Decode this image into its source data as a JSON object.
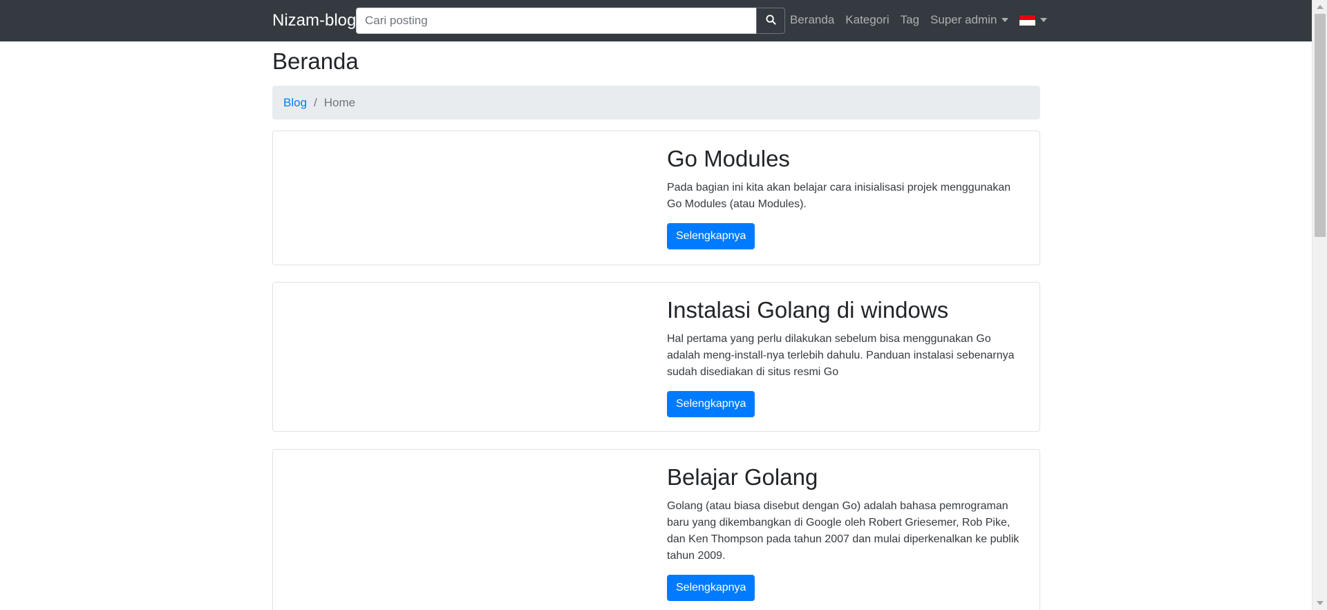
{
  "navbar": {
    "brand": "Nizam-blog",
    "search_placeholder": "Cari posting",
    "search_icon": "search-icon",
    "links": [
      {
        "label": "Beranda"
      },
      {
        "label": "Kategori"
      },
      {
        "label": "Tag"
      }
    ],
    "user_menu": "Super admin",
    "language_flag": "indonesia-flag-icon"
  },
  "page": {
    "title": "Beranda"
  },
  "breadcrumb": {
    "link": "Blog",
    "separator": "/",
    "active": "Home"
  },
  "posts": [
    {
      "title": "Go Modules",
      "excerpt": "Pada bagian ini kita akan belajar cara inisialisasi projek menggunakan Go Modules (atau Modules).",
      "button": "Selengkapnya"
    },
    {
      "title": "Instalasi Golang di windows",
      "excerpt": "Hal pertama yang perlu dilakukan sebelum bisa menggunakan Go adalah meng-install-nya terlebih dahulu. Panduan instalasi sebenarnya sudah disediakan di situs resmi Go",
      "button": "Selengkapnya"
    },
    {
      "title": "Belajar Golang",
      "excerpt": "Golang (atau biasa disebut dengan Go) adalah bahasa pemrograman baru yang dikembangkan di Google oleh Robert Griesemer, Rob Pike, dan Ken Thompson pada tahun 2007 dan mulai diperkenalkan ke publik tahun 2009.",
      "button": "Selengkapnya"
    }
  ],
  "colors": {
    "navbar_bg": "#343a40",
    "primary": "#007bff",
    "breadcrumb_bg": "#e9ecef"
  }
}
